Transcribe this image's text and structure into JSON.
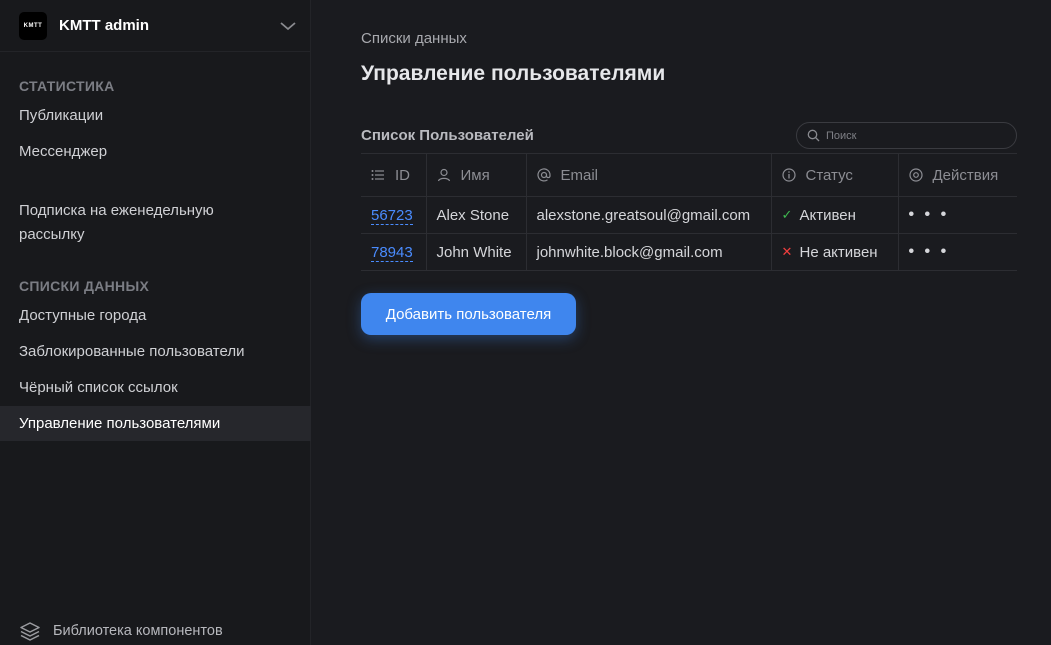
{
  "brand": {
    "logo_text": "KMTT",
    "name": "KMTT admin"
  },
  "sidebar": {
    "section_stats": "СТАТИСТИКА",
    "stats_items": [
      "Публикации",
      "Мессенджер"
    ],
    "subscription_line1": "Подписка на еженедельную",
    "subscription_line2": "рассылку",
    "section_lists": "СПИСКИ ДАННЫХ",
    "list_items": [
      "Доступные города",
      "Заблокированные пользователи",
      "Чёрный список ссылок",
      "Управление пользователями"
    ],
    "active_item": "Управление пользователями",
    "footer": "Библиотека компонентов"
  },
  "main": {
    "breadcrumb": "Списки данных",
    "title": "Управление пользователями",
    "list_title": "Список Пользователей",
    "search_placeholder": "Поиск",
    "columns": {
      "id": "ID",
      "name": "Имя",
      "email": "Email",
      "status": "Статус",
      "actions": "Действия"
    },
    "rows": [
      {
        "id": "56723",
        "name": "Alex Stone",
        "email": "alexstone.greatsoul@gmail.com",
        "status": "Активен",
        "status_mark": "✓",
        "status_color": "#3fb950"
      },
      {
        "id": "78943",
        "name": "John White",
        "email": "johnwhite.block@gmail.com",
        "status": "Не активен",
        "status_mark": "✕",
        "status_color": "#f03e3e"
      }
    ],
    "actions_label": "• • •",
    "add_button": "Добавить пользователя"
  },
  "colors": {
    "accent": "#3f86ee",
    "link": "#4a8cff",
    "background": "#1a1b1f"
  }
}
